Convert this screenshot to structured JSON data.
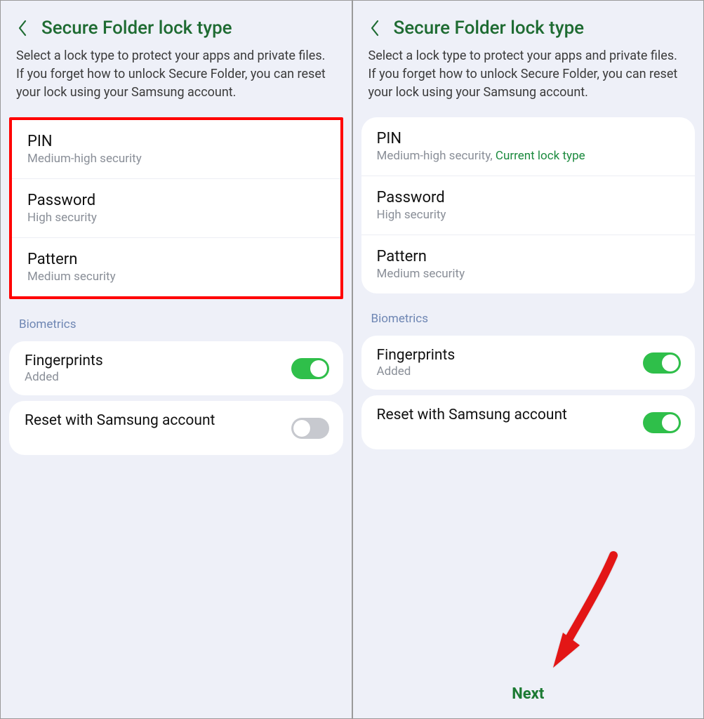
{
  "left": {
    "title": "Secure Folder lock type",
    "description": "Select a lock type to protect your apps and private files. If you forget how to unlock Secure Folder, you can reset your lock using your Samsung account.",
    "options": {
      "pin": {
        "title": "PIN",
        "sub": "Medium-high security"
      },
      "password": {
        "title": "Password",
        "sub": "High security"
      },
      "pattern": {
        "title": "Pattern",
        "sub": "Medium security"
      }
    },
    "biometrics_label": "Biometrics",
    "fingerprints": {
      "title": "Fingerprints",
      "sub": "Added",
      "on": true
    },
    "reset": {
      "title": "Reset with Samsung account",
      "on": false
    }
  },
  "right": {
    "title": "Secure Folder lock type",
    "description": "Select a lock type to protect your apps and private files. If you forget how to unlock Secure Folder, you can reset your lock using your Samsung account.",
    "options": {
      "pin": {
        "title": "PIN",
        "sub": "Medium-high security,",
        "current": "Current lock type"
      },
      "password": {
        "title": "Password",
        "sub": "High security"
      },
      "pattern": {
        "title": "Pattern",
        "sub": "Medium security"
      }
    },
    "biometrics_label": "Biometrics",
    "fingerprints": {
      "title": "Fingerprints",
      "sub": "Added",
      "on": true
    },
    "reset": {
      "title": "Reset with Samsung account",
      "on": true
    },
    "next_label": "Next"
  }
}
